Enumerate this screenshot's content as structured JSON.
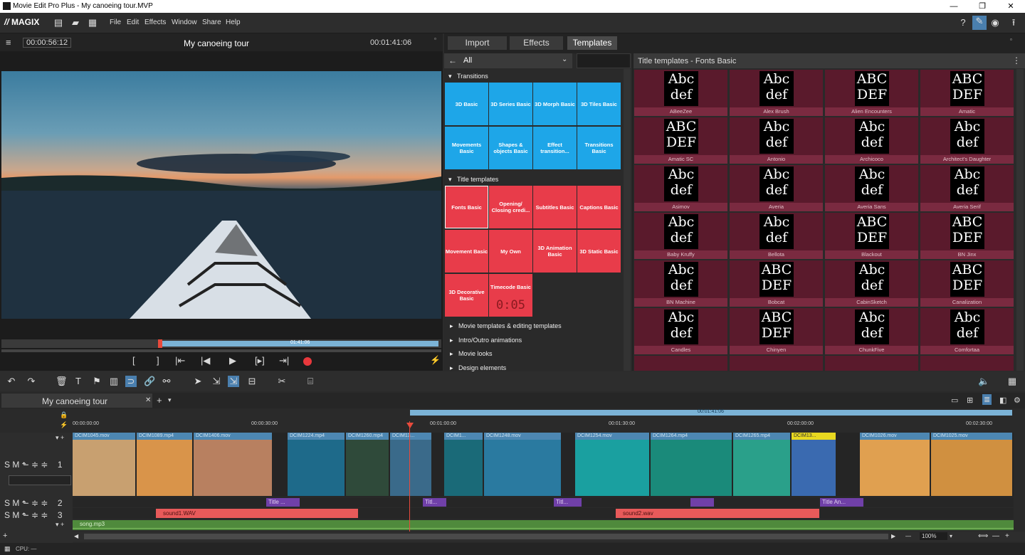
{
  "window": {
    "title": "Movie Edit Pro Plus - My canoeing tour.MVP"
  },
  "menu": {
    "logo": "MAGIX",
    "items": [
      "File",
      "Edit",
      "Effects",
      "Window",
      "Share",
      "Help"
    ]
  },
  "preview": {
    "timecode_left": "00:00:56:12",
    "title": "My canoeing tour",
    "timecode_right": "00:01:41:06",
    "scrub_time": "01:41:06"
  },
  "panel": {
    "tabs": [
      "Import",
      "Effects",
      "Templates"
    ],
    "filter": "All",
    "sections": {
      "transitions": "Transitions",
      "title_templates": "Title templates"
    },
    "transition_tiles": [
      "3D Basic",
      "3D Series Basic",
      "3D Morph Basic",
      "3D Tiles Basic",
      "Movements Basic",
      "Shapes & objects Basic",
      "Effect transition...",
      "Transitions Basic"
    ],
    "title_tiles": [
      "Fonts Basic",
      "Opening/ Closing credi...",
      "Subtitles Basic",
      "Captions Basic",
      "Movement Basic",
      "My Own",
      "3D Animation Basic",
      "3D Static Basic",
      "3D Decorative Basic",
      "Timecode Basic"
    ],
    "timecode_glyph": "0:05",
    "more_sections": [
      "Movie templates & editing templates",
      "Intro/Outro animations",
      "Movie looks",
      "Design elements"
    ],
    "font_header": "Title templates - Fonts Basic",
    "fonts": [
      {
        "name": "ABeeZee",
        "glyph": "Abc def"
      },
      {
        "name": "Alex Brush",
        "glyph": "Abc def"
      },
      {
        "name": "Alien Encounters",
        "glyph": "ABC DEF"
      },
      {
        "name": "Amatic",
        "glyph": "ABC DEF"
      },
      {
        "name": "Amatic SC",
        "glyph": "ABC DEF"
      },
      {
        "name": "Antonio",
        "glyph": "Abc def"
      },
      {
        "name": "Archicoco",
        "glyph": "Abc def"
      },
      {
        "name": "Architect's Daughter",
        "glyph": "Abc def"
      },
      {
        "name": "Asimov",
        "glyph": "Abc def"
      },
      {
        "name": "Averia",
        "glyph": "Abc def"
      },
      {
        "name": "Averia Sans",
        "glyph": "Abc def"
      },
      {
        "name": "Averia Serif",
        "glyph": "Abc def"
      },
      {
        "name": "Baby Kruffy",
        "glyph": "Abc def"
      },
      {
        "name": "Bellota",
        "glyph": "Abc def"
      },
      {
        "name": "Blackout",
        "glyph": "ABC DEF"
      },
      {
        "name": "BN Jinx",
        "glyph": "ABC DEF"
      },
      {
        "name": "BN Machine",
        "glyph": "Abc def"
      },
      {
        "name": "Bobcat",
        "glyph": "ABC DEF"
      },
      {
        "name": "CabinSketch",
        "glyph": "Abc def"
      },
      {
        "name": "Canalization",
        "glyph": "ABC DEF"
      },
      {
        "name": "Candles",
        "glyph": "Abc def"
      },
      {
        "name": "Chinyen",
        "glyph": "ABC DEF"
      },
      {
        "name": "ChunkFive",
        "glyph": "Abc def"
      },
      {
        "name": "Comfortaa",
        "glyph": "Abc def"
      }
    ]
  },
  "timeline": {
    "tab": "My canoeing tour",
    "range_time": "00:01:41:06",
    "ruler": [
      "00:00:00:00",
      "00:00:30:00",
      "00:01:00:00",
      "00:01:30:00",
      "00:02:00:00",
      "00:02:30:00"
    ],
    "clips": [
      "DCIM1045.mov",
      "DCIM1089.mp4",
      "DCIM1406.mov",
      "DCIM1224.mp4",
      "DCIM1260.mp4",
      "DCIM13...",
      "DCIM1...",
      "DCIM1248.mov",
      "DCIM1254.mov",
      "DCIM1264.mp4",
      "DCIM1265.mp4",
      "DCIM13...",
      "DCIM1026.mov",
      "DCIM1025.mov"
    ],
    "titles": [
      "Title ...",
      "Titl...",
      "Titl...",
      "",
      "Title An..."
    ],
    "track_labels": [
      "1",
      "2",
      "3"
    ],
    "track_ctrl": "S M",
    "audio": [
      "sound1.WAV",
      "sound2.wav"
    ],
    "song": "song.mp3",
    "zoom": "100%",
    "cpu": "CPU: —"
  }
}
